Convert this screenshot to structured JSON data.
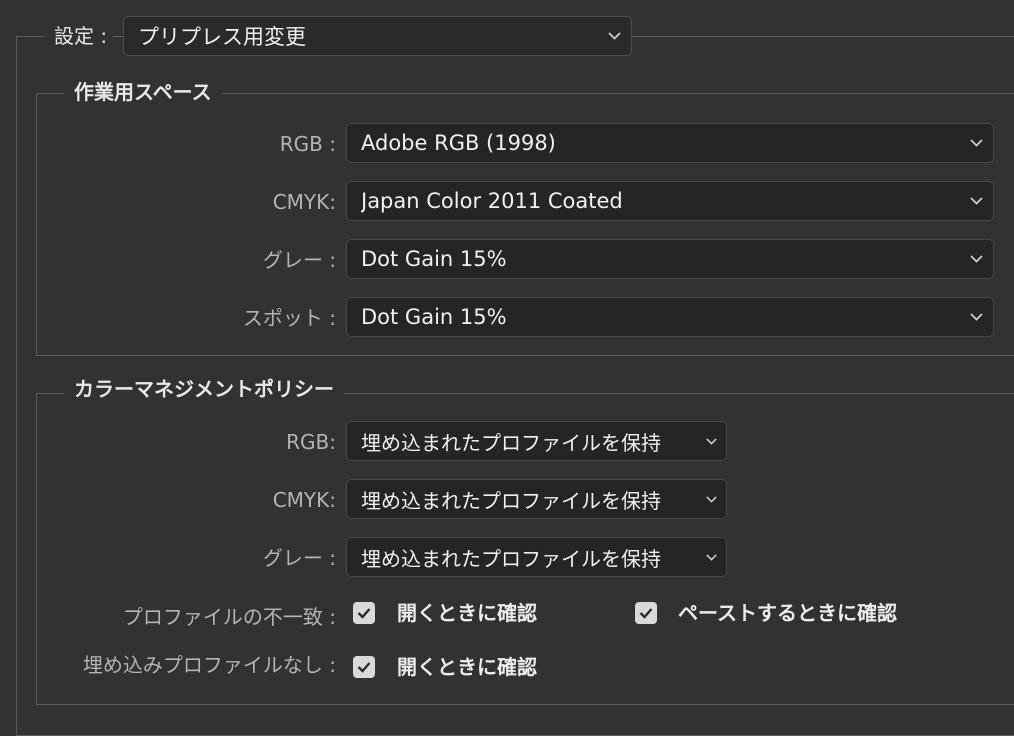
{
  "settings": {
    "label": "設定 :",
    "value": "プリプレス用変更"
  },
  "working_spaces": {
    "title": "作業用スペース",
    "rgb": {
      "label": "RGB :",
      "value": "Adobe RGB (1998)"
    },
    "cmyk": {
      "label": "CMYK:",
      "value": "Japan Color 2011 Coated"
    },
    "gray": {
      "label": "グレー :",
      "value": "Dot Gain 15%"
    },
    "spot": {
      "label": "スポット :",
      "value": "Dot Gain 15%"
    }
  },
  "policies": {
    "title": "カラーマネジメントポリシー",
    "rgb": {
      "label": "RGB:",
      "value": "埋め込まれたプロファイルを保持"
    },
    "cmyk": {
      "label": "CMYK:",
      "value": "埋め込まれたプロファイルを保持"
    },
    "gray": {
      "label": "グレー :",
      "value": "埋め込まれたプロファイルを保持"
    },
    "mismatch": {
      "label": "プロファイルの不一致 :",
      "ask_open_label": "開くときに確認",
      "ask_open_checked": true,
      "ask_paste_label": "ペーストするときに確認",
      "ask_paste_checked": true
    },
    "missing": {
      "label": "埋め込みプロファイルなし :",
      "ask_open_label": "開くときに確認",
      "ask_open_checked": true
    }
  },
  "icons": {
    "dropdown": "chevron-down-icon",
    "checkbox": "checkmark-icon"
  },
  "colors": {
    "background": "#323232",
    "field": "#252525",
    "checkbox": "#d9d9d9"
  }
}
